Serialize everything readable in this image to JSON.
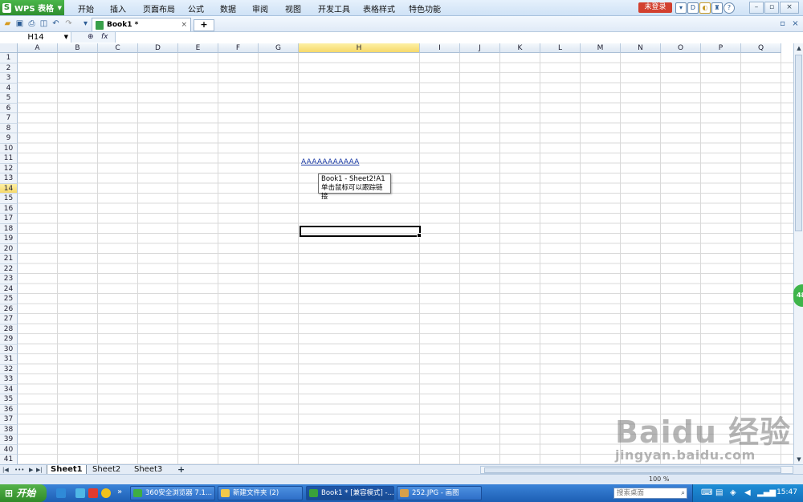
{
  "app": {
    "name": "WPS 表格"
  },
  "menu": {
    "items": [
      "开始",
      "插入",
      "页面布局",
      "公式",
      "数据",
      "审阅",
      "视图",
      "开发工具",
      "表格样式",
      "特色功能"
    ],
    "login_label": "未登录"
  },
  "toolbar": {
    "doc_tab_label": "Book1 *",
    "tab_close": "×",
    "new_tab": "+"
  },
  "formula_bar": {
    "cell_ref": "H14",
    "fx_label": "fx",
    "zoom_symbol": "⊕",
    "content": ""
  },
  "grid": {
    "columns": [
      "A",
      "B",
      "C",
      "D",
      "E",
      "F",
      "G",
      "H",
      "I",
      "J",
      "K",
      "L",
      "M",
      "N",
      "O",
      "P",
      "Q"
    ],
    "rows": [
      "1",
      "2",
      "3",
      "4",
      "5",
      "6",
      "7",
      "8",
      "9",
      "10",
      "11",
      "12",
      "13",
      "14",
      "15",
      "16",
      "17",
      "18",
      "19",
      "20",
      "21",
      "22",
      "23",
      "24",
      "25",
      "26",
      "27",
      "28",
      "29",
      "30",
      "31",
      "32",
      "33",
      "34",
      "35",
      "36",
      "37",
      "38",
      "39",
      "40",
      "41"
    ],
    "active_column": "H",
    "active_row": "14",
    "hyperlink_text": "AAAAAAAAAAA",
    "tooltip_line1": "Book1 - Sheet2!A1",
    "tooltip_line2": "单击鼠标可以跟踪链接"
  },
  "sheets": {
    "tabs": [
      "Sheet1",
      "Sheet2",
      "Sheet3"
    ],
    "active": "Sheet1",
    "add": "+"
  },
  "status": {
    "zoom_text": "100 %"
  },
  "taskbar": {
    "start_label": "开始",
    "more": "»",
    "buttons": [
      "360安全浏览器 7.1...",
      "新建文件夹 (2)",
      "Book1 * [兼容模式] -...",
      "252.JPG - 画图"
    ],
    "search_placeholder": "搜索桌面",
    "clock": "15:47"
  },
  "float_ball": "48",
  "watermark": {
    "main": "Baidu 经验",
    "sub": "jingyan.baidu.com"
  },
  "colors": {
    "wps_green": "#3aa23a",
    "login_red": "#d2402f",
    "active_header": "#f6d96a",
    "taskbar_blue": "#2e6fc8",
    "hyperlink": "#1a3aa6"
  }
}
